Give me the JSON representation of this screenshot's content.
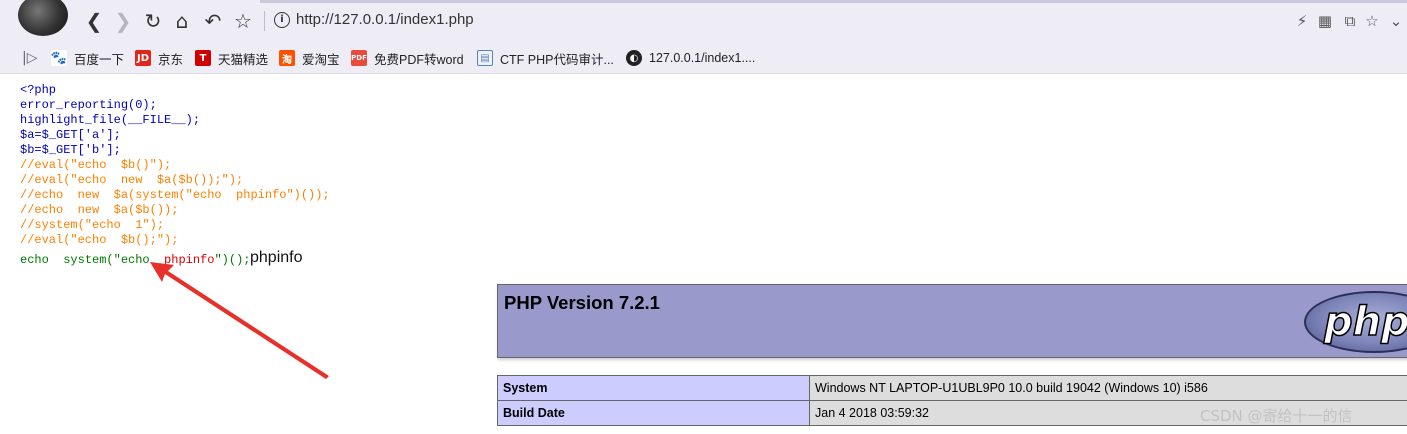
{
  "browser": {
    "url": "http://127.0.0.1/index1.php",
    "bookmarks": [
      {
        "label": "百度一下",
        "icon": "baidu-icon"
      },
      {
        "label": "京东",
        "icon": "jd-icon"
      },
      {
        "label": "天猫精选",
        "icon": "tmall-icon"
      },
      {
        "label": "爱淘宝",
        "icon": "taobao-icon"
      },
      {
        "label": "免费PDF转word",
        "icon": "pdf-icon"
      },
      {
        "label": "CTF PHP代码审计...",
        "icon": "document-icon"
      },
      {
        "label": "127.0.0.1/index1....",
        "icon": "globe-icon"
      }
    ]
  },
  "code": {
    "lines": [
      "<?php",
      "error_reporting(0);",
      "highlight_file(__FILE__);",
      "$a=$_GET['a'];",
      "$b=$_GET['b'];",
      "//eval(\"echo  $b()\");",
      "//eval(\"echo  new  $a($b());\");",
      "//echo  new  $a(system(\"echo  phpinfo\")());",
      "//echo  new  $a($b());",
      "//system(\"echo  1\");",
      "//eval(\"echo  $b();\");"
    ],
    "last_line": {
      "echo": "echo",
      "system_open": "system(\"echo",
      "arg": "phpinfo",
      "close": "\")();"
    },
    "output": "phpinfo"
  },
  "phpinfo": {
    "title": "PHP Version 7.2.1",
    "logo_text": "php",
    "rows": [
      {
        "key": "System",
        "value": "Windows NT LAPTOP-U1UBL9P0 10.0 build 19042 (Windows 10) i586"
      },
      {
        "key": "Build Date",
        "value": "Jan 4 2018 03:59:32"
      }
    ]
  },
  "watermark": "CSDN @寄给十一的信",
  "colors": {
    "php_keyword": "#0000bb",
    "php_comment": "#ff8000",
    "php_function": "#007700",
    "php_string": "#dd0000",
    "phpinfo_header": "#9999cc",
    "annotation_arrow": "#e8302a"
  }
}
